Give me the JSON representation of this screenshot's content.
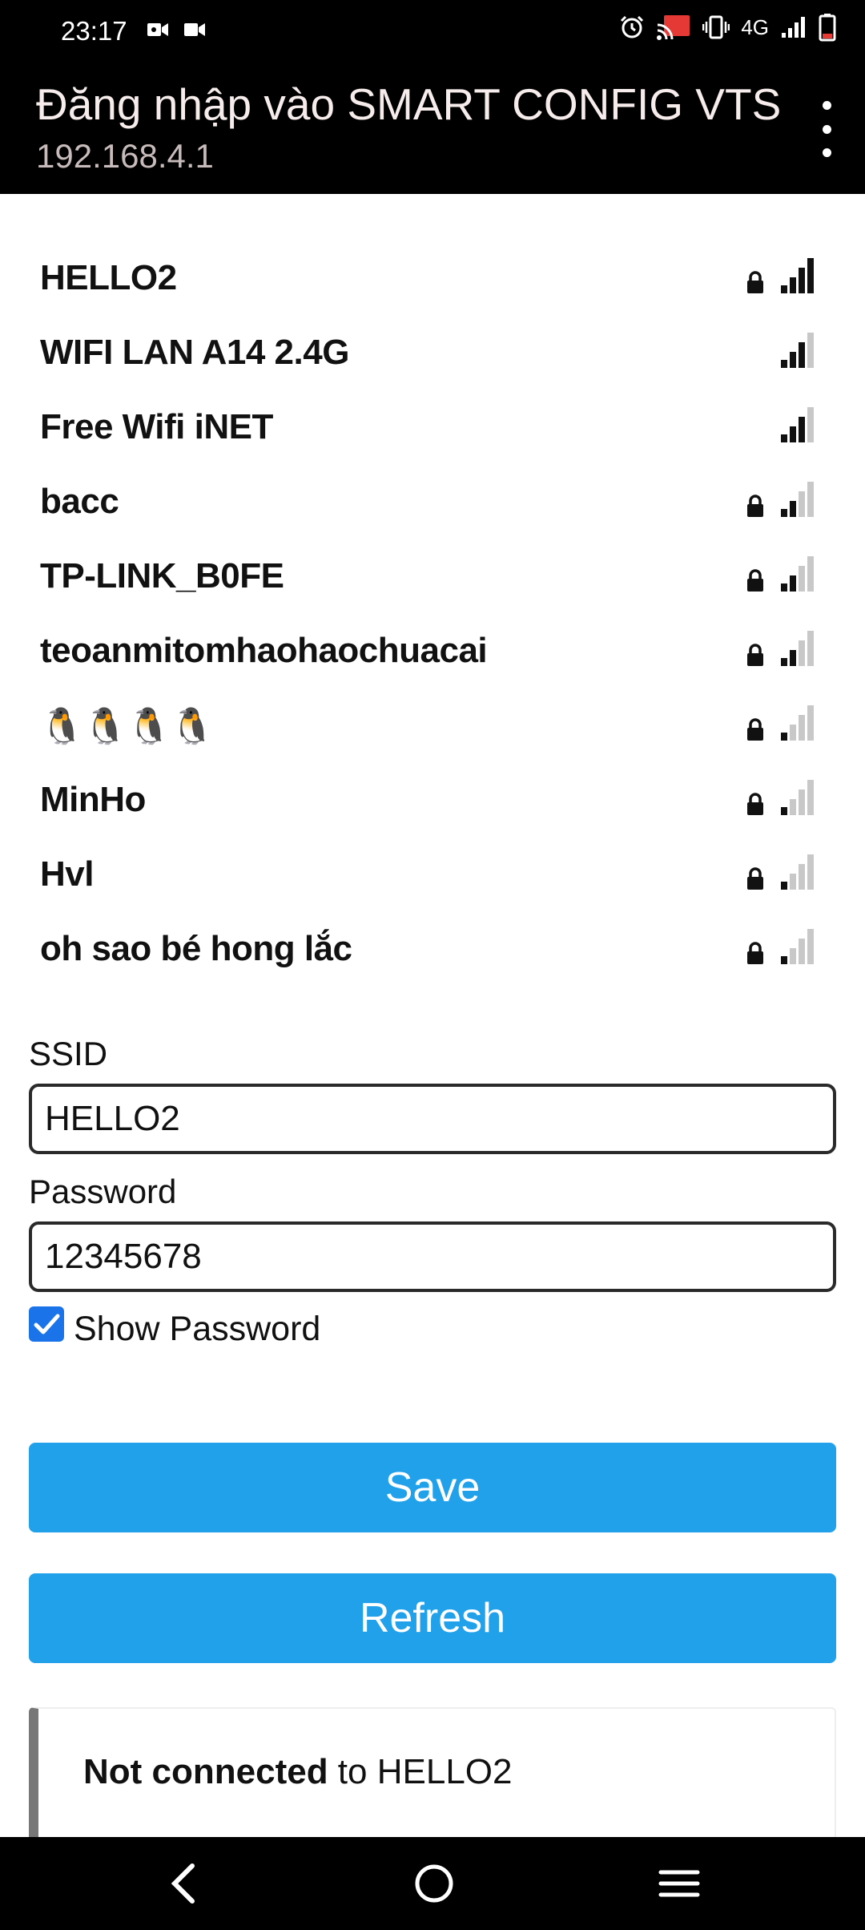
{
  "statusbar": {
    "time": "23:17",
    "network": "4G"
  },
  "appbar": {
    "title": "Đăng nhập vào SMART CONFIG VTS",
    "subtitle": "192.168.4.1"
  },
  "networks": [
    {
      "ssid": "HELLO2",
      "locked": true,
      "bars": 4
    },
    {
      "ssid": "WIFI LAN A14 2.4G",
      "locked": false,
      "bars": 3
    },
    {
      "ssid": "Free Wifi iNET",
      "locked": false,
      "bars": 3
    },
    {
      "ssid": "bacc",
      "locked": true,
      "bars": 2
    },
    {
      "ssid": "TP-LINK_B0FE",
      "locked": true,
      "bars": 2
    },
    {
      "ssid": "teoanmitomhaohaochuacai",
      "locked": true,
      "bars": 2
    },
    {
      "ssid": "🐧🐧🐧🐧",
      "locked": true,
      "bars": 1
    },
    {
      "ssid": "MinHo",
      "locked": true,
      "bars": 1
    },
    {
      "ssid": "Hvl",
      "locked": true,
      "bars": 1
    },
    {
      "ssid": "oh sao bé hong lắc",
      "locked": true,
      "bars": 1
    }
  ],
  "form": {
    "ssid_label": "SSID",
    "ssid_value": "HELLO2",
    "password_label": "Password",
    "password_value": "12345678",
    "show_password_label": "Show Password",
    "show_password_checked": true
  },
  "buttons": {
    "save": "Save",
    "refresh": "Refresh"
  },
  "status": {
    "bold": "Not connected",
    "rest": " to HELLO2"
  },
  "colors": {
    "accent": "#21a1ea",
    "checkbox": "#1a73e8",
    "bar_dark": "#111111",
    "bar_light": "#c8c8c8"
  }
}
